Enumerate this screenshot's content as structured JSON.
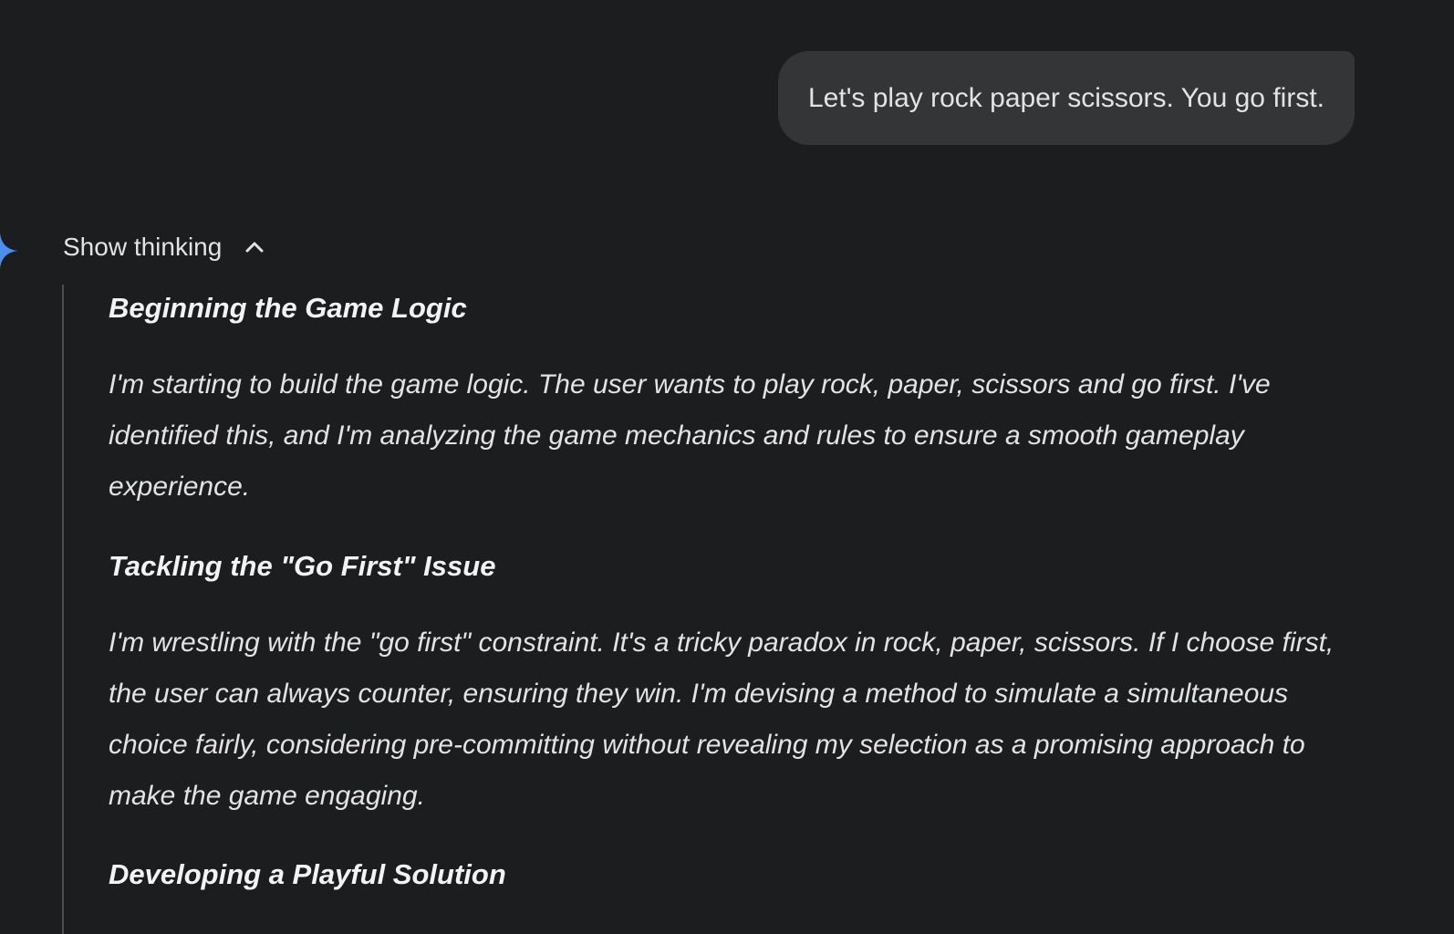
{
  "user_message": {
    "text": "Let's play rock paper scissors. You go first."
  },
  "assistant": {
    "icon": "spark-icon",
    "accent_color": "#4285f4",
    "thinking_toggle": {
      "label": "Show thinking",
      "icon": "chevron-up-icon"
    },
    "thoughts": [
      {
        "heading": "Beginning the Game Logic",
        "body": "I'm starting to build the game logic. The user wants to play rock, paper, scissors and go first. I've identified this, and I'm analyzing the game mechanics and rules to ensure a smooth gameplay experience."
      },
      {
        "heading": "Tackling the \"Go First\" Issue",
        "body": "I'm wrestling with the \"go first\" constraint.  It's a tricky paradox in rock, paper, scissors.  If I choose first, the user can always counter, ensuring they win.  I'm devising a method to simulate a simultaneous choice fairly, considering pre-committing without revealing my selection as a promising approach to make the game engaging."
      },
      {
        "heading": "Developing a Playful Solution",
        "body": ""
      }
    ]
  }
}
